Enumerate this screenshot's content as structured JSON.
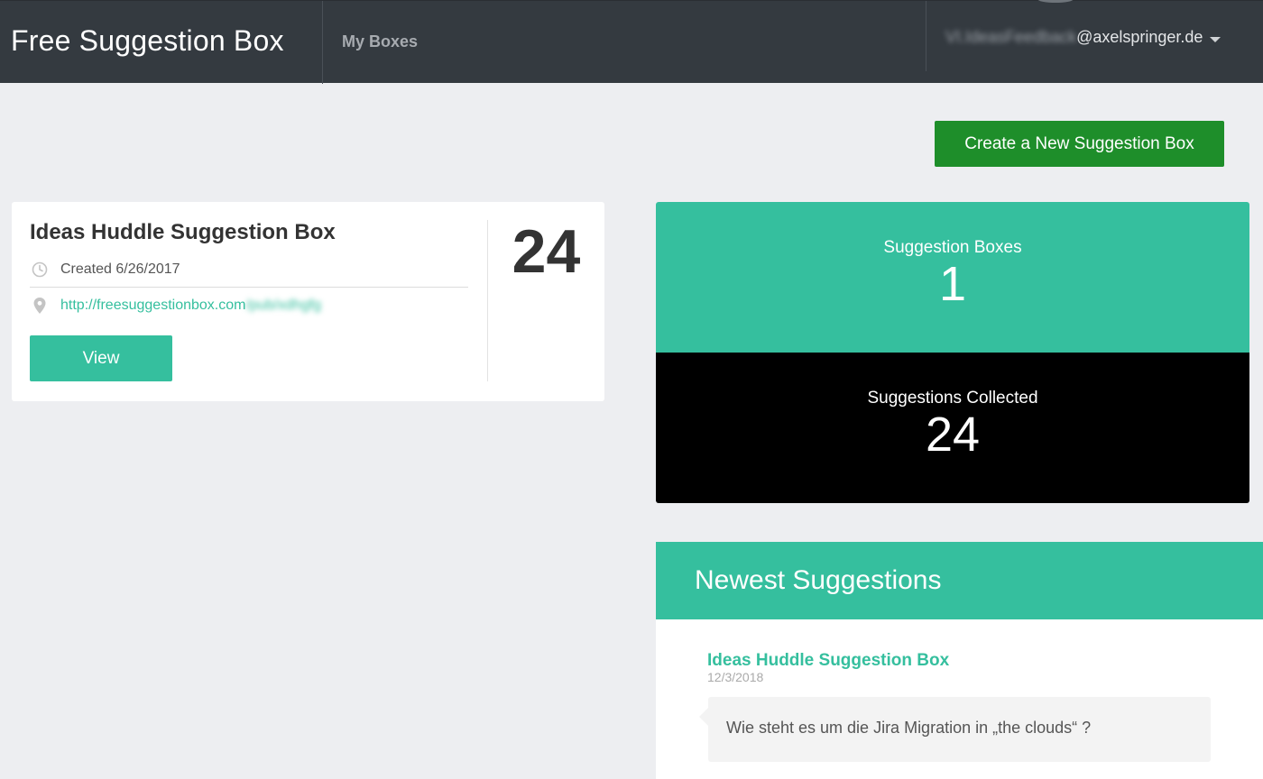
{
  "topbar": {
    "brand": "Free Suggestion Box",
    "nav_my_boxes": "My Boxes",
    "user_redacted": "VI.IdeasFeedback",
    "user_domain": "@axelspringer.de"
  },
  "actions": {
    "create_box": "Create a New Suggestion Box"
  },
  "box_card": {
    "title": "Ideas Huddle Suggestion Box",
    "created": "Created 6/26/2017",
    "link_visible": "http://freesuggestionbox.com",
    "link_redacted": "/pub/xdhgfg",
    "view_label": "View",
    "count": "24"
  },
  "stats": {
    "boxes_label": "Suggestion Boxes",
    "boxes_value": "1",
    "collected_label": "Suggestions Collected",
    "collected_value": "24"
  },
  "newest": {
    "header": "Newest Suggestions",
    "items": [
      {
        "box_name": "Ideas Huddle Suggestion Box",
        "date": "12/3/2018",
        "text": "Wie steht es um die Jira Migration in „the clouds“ ?"
      }
    ]
  },
  "colors": {
    "accent": "#35bf9e",
    "create_button": "#1e8e2a",
    "topbar": "#343a40",
    "background": "#edeef1"
  },
  "icons": {
    "created": "clock-icon",
    "link": "map-pin-icon",
    "user_menu": "caret-down-icon"
  }
}
